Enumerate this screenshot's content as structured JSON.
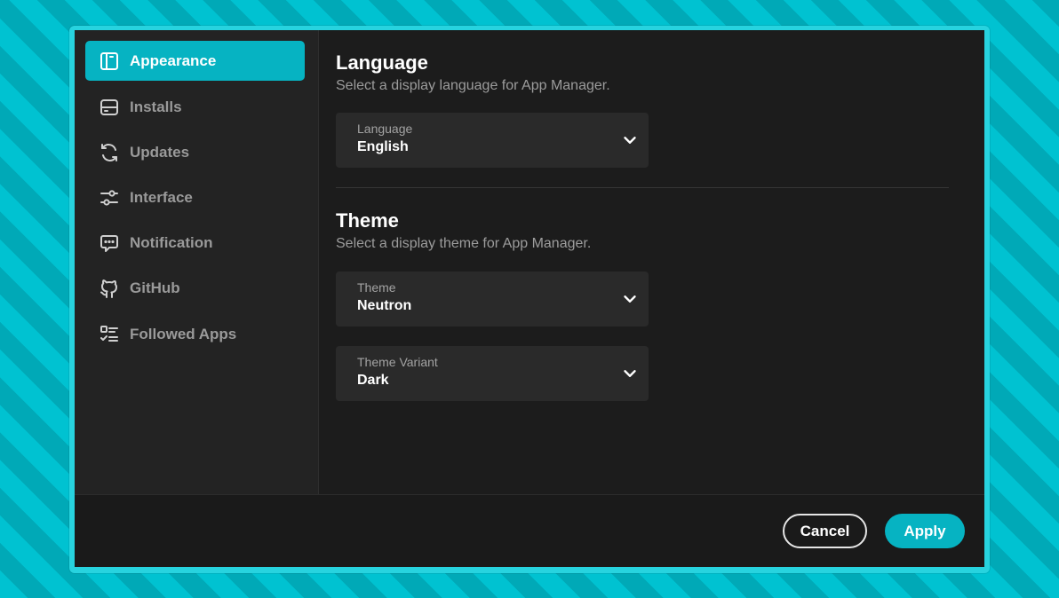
{
  "sidebar": {
    "items": [
      {
        "label": "Appearance",
        "icon": "appearance-icon",
        "active": true
      },
      {
        "label": "Installs",
        "icon": "drive-icon",
        "active": false
      },
      {
        "label": "Updates",
        "icon": "refresh-icon",
        "active": false
      },
      {
        "label": "Interface",
        "icon": "sliders-icon",
        "active": false
      },
      {
        "label": "Notification",
        "icon": "message-icon",
        "active": false
      },
      {
        "label": "GitHub",
        "icon": "github-icon",
        "active": false
      },
      {
        "label": "Followed Apps",
        "icon": "checklist-icon",
        "active": false
      }
    ]
  },
  "language_section": {
    "title": "Language",
    "description": "Select a display language for App Manager.",
    "language_dropdown": {
      "label": "Language",
      "value": "English"
    }
  },
  "theme_section": {
    "title": "Theme",
    "description": "Select a display theme for App Manager.",
    "theme_dropdown": {
      "label": "Theme",
      "value": "Neutron"
    },
    "variant_dropdown": {
      "label": "Theme Variant",
      "value": "Dark"
    }
  },
  "footer": {
    "cancel_label": "Cancel",
    "apply_label": "Apply"
  },
  "colors": {
    "accent": "#06b3c2",
    "background": "#1c1c1c",
    "sidebar": "#232323",
    "dropdown": "#2a2a2a"
  }
}
